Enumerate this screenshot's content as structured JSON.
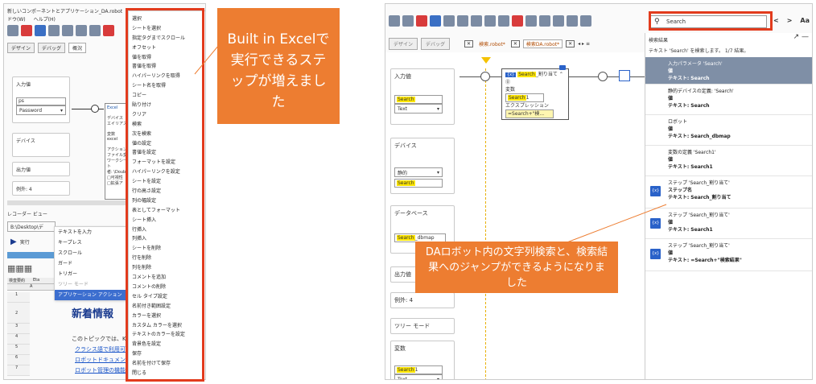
{
  "left_app": {
    "title": "新しいコンポーネントとアプリケーション_DA.robot",
    "menus": [
      "ドウ(W)",
      "ヘルプ(H)"
    ],
    "tabs": [
      "デザイン",
      "デバッグ"
    ],
    "tab_overview": "概況",
    "input_label": "入力値",
    "input_field_value": "ps",
    "input_type": "Password",
    "excel_node": "Excel",
    "node_lines": [
      "デバイス",
      "エイリアス",
      "変数",
      "excel",
      "アクション",
      "ファイル変",
      "ワークシート",
      "者: \\Doub",
      "□可視性",
      "□拡張ア"
    ],
    "device_label": "デバイス",
    "output_label": "出力値",
    "example_label": "例外: 4",
    "recorder_label": "レコーダー ビュー",
    "recorder_path": "B:\\Desktop\\デ",
    "exec_label": "実行",
    "grid_header": [
      "検査要約",
      "Eta"
    ],
    "grid_col": "A",
    "grid_rows": [
      "1",
      "2",
      "3",
      "4",
      "5",
      "6",
      "7"
    ],
    "news_title": "新着情報",
    "body_lines": [
      "このトピックでは、K",
      "クラシス語で利用可",
      "ロボットドキュメン",
      "ロボット管理の機能"
    ],
    "submenu": [
      "テキストを入力",
      "キープレス",
      "スクロール",
      "ガード",
      "トリガー",
      "ツリー モード",
      "アプリケーション アクション"
    ],
    "big_menu": [
      "選択",
      "シートを選択",
      "指定タグまでスクロール",
      "オフセット",
      "値を取得",
      "書値を取得",
      "ハイパーリンクを取得",
      "シート名を取得",
      "コピー",
      "貼り付け",
      "クリア",
      "検索",
      "次を検索",
      "値の設定",
      "書値を設定",
      "フォーマットを設定",
      "ハイパーリンクを設定",
      "シートを設定",
      "行の高さ設定",
      "列の幅設定",
      "表としてフォーマット",
      "シート挿入",
      "行挿入",
      "列挿入",
      "シートを削除",
      "行を削除",
      "列を削除",
      "コメントを追加",
      "コメントの削除",
      "セル タイプ設定",
      "名前付き範囲設定",
      "カラーを選択",
      "カスタム カラーを選択",
      "テキストのカラーを設定",
      "背景色を設定",
      "保存",
      "名前を付けて保存",
      "閉じる"
    ]
  },
  "callout_left": "Built in Excelで実行できるステップが増えました",
  "right_app": {
    "tabs": [
      "検索.robot*",
      "検索DA.robot*"
    ],
    "search_value": "Search",
    "search_nav": [
      "<",
      ">",
      "Aa"
    ],
    "results_title": "検索結果",
    "results_summary": "テキスト 'Search' を検索します。 1/7 結果。",
    "input_label": "入力値",
    "input_value_hl": "Search",
    "input_type": "Text",
    "assign_node_hl": "Search",
    "assign_node_rest": "_割り当て",
    "node_var_label": "変数",
    "node_var_hl": "Search",
    "node_var_rest": "1",
    "node_expr_label": "エクスプレッション",
    "node_expr_value": "=Search+\"検...",
    "device_label": "デバイス",
    "device_type": "静的",
    "device_value_hl": "Search",
    "db_label": "データベース",
    "db_value_hl": "Search",
    "db_value_rest": "_dbmap",
    "output_label": "出力値",
    "example_label": "例外: 4",
    "tree_label": "ツリー モード",
    "var_label": "変数",
    "var_value_hl": "Search",
    "var_value_rest": "1",
    "var_type": "Text",
    "results": [
      {
        "title": "入力パラメータ 'Search'",
        "sub": "値",
        "text": "テキスト: Search",
        "icon": false
      },
      {
        "title": "静的デバイスの定義: 'Search'",
        "sub": "値",
        "text": "テキスト: Search",
        "icon": false
      },
      {
        "title": "ロボット",
        "sub": "値",
        "text": "テキスト: Search_dbmap",
        "icon": false
      },
      {
        "title": "変数の定義 'Search1'",
        "sub": "値",
        "text": "テキスト: Search1",
        "icon": false
      },
      {
        "title": "ステップ 'Search_割り当て'",
        "sub": "ステップ名",
        "text": "テキスト: Search_割り当て",
        "icon": true
      },
      {
        "title": "ステップ 'Search_割り当て'",
        "sub": "値",
        "text": "テキスト: Search1",
        "icon": true
      },
      {
        "title": "ステップ 'Search_割り当て'",
        "sub": "値",
        "text": "テキスト: =Search+\"検索結果\"",
        "icon": true
      }
    ]
  },
  "callout_right": "DAロボット内の文字列検索と、検索結果へのジャンプができるようになりました",
  "colors": {
    "orange": "#ed7d31",
    "red_box": "#e23b1d",
    "selected_result": "#7f8fa6",
    "highlight": "#ffe600"
  }
}
